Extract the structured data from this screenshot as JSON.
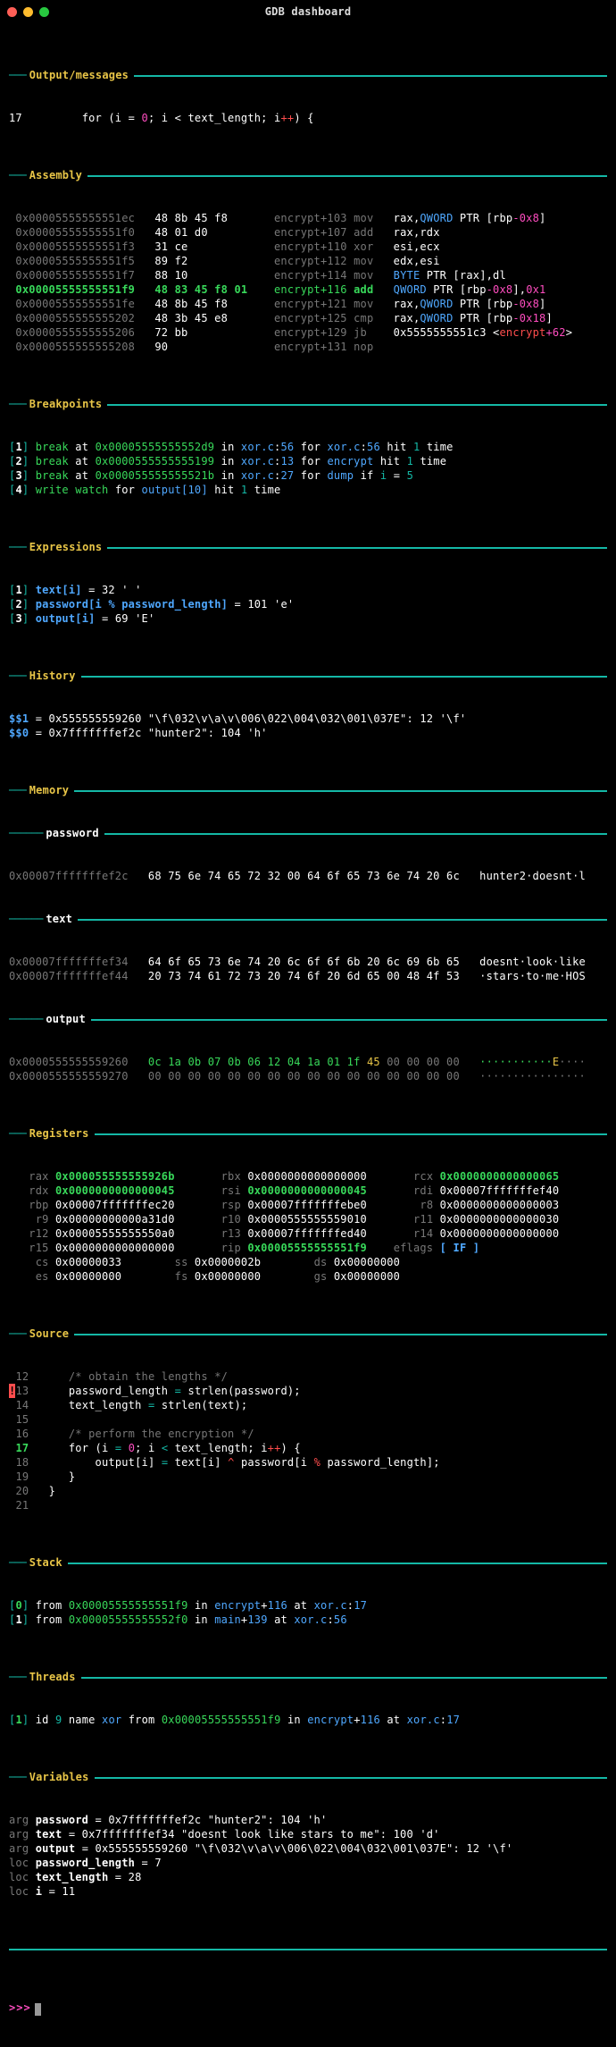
{
  "window": {
    "title": "GDB dashboard"
  },
  "sections": {
    "output_messages": "Output/messages",
    "assembly": "Assembly",
    "breakpoints": "Breakpoints",
    "expressions": "Expressions",
    "history": "History",
    "memory": "Memory",
    "registers": "Registers",
    "source": "Source",
    "stack": "Stack",
    "threads": "Threads",
    "variables": "Variables"
  },
  "output_line": {
    "num": "17",
    "prefix": "for (i = ",
    "zero": "0",
    "mid": "; i < text_length; i",
    "op": "++",
    "end": ") {"
  },
  "assembly": [
    {
      "addr": " 0x00005555555551ec ",
      "bytes": "  48 8b 45 f8       ",
      "loc": "encrypt+103 ",
      "mn": "mov   ",
      "ops": [
        [
          "wh",
          "rax,"
        ],
        [
          "bl",
          "QWORD"
        ],
        [
          "wh",
          " PTR [rbp"
        ],
        [
          "pk",
          "-0x8"
        ],
        [
          "wh",
          "]"
        ]
      ]
    },
    {
      "addr": " 0x00005555555551f0 ",
      "bytes": "  48 01 d0          ",
      "loc": "encrypt+107 ",
      "mn": "add   ",
      "ops": [
        [
          "wh",
          "rax,rdx"
        ]
      ]
    },
    {
      "addr": " 0x00005555555551f3 ",
      "bytes": "  31 ce             ",
      "loc": "encrypt+110 ",
      "mn": "xor   ",
      "ops": [
        [
          "wh",
          "esi,ecx"
        ]
      ]
    },
    {
      "addr": " 0x00005555555551f5 ",
      "bytes": "  89 f2             ",
      "loc": "encrypt+112 ",
      "mn": "mov   ",
      "ops": [
        [
          "wh",
          "edx,esi"
        ]
      ]
    },
    {
      "addr": " 0x00005555555551f7 ",
      "bytes": "  88 10             ",
      "loc": "encrypt+114 ",
      "mn": "mov   ",
      "ops": [
        [
          "bl",
          "BYTE"
        ],
        [
          "wh",
          " PTR [rax],dl"
        ]
      ]
    },
    {
      "addr": " 0x00005555555551f9 ",
      "bytes": "  48 83 45 f8 01    ",
      "loc": "encrypt+116 ",
      "mn": "add   ",
      "ops": [
        [
          "bl",
          "QWORD"
        ],
        [
          "wh",
          " PTR [rbp"
        ],
        [
          "pk",
          "-0x8"
        ],
        [
          "wh",
          "],"
        ],
        [
          "pk",
          "0x1"
        ]
      ],
      "cur": true
    },
    {
      "addr": " 0x00005555555551fe ",
      "bytes": "  48 8b 45 f8       ",
      "loc": "encrypt+121 ",
      "mn": "mov   ",
      "ops": [
        [
          "wh",
          "rax,"
        ],
        [
          "bl",
          "QWORD"
        ],
        [
          "wh",
          " PTR [rbp"
        ],
        [
          "pk",
          "-0x8"
        ],
        [
          "wh",
          "]"
        ]
      ]
    },
    {
      "addr": " 0x0000555555555202 ",
      "bytes": "  48 3b 45 e8       ",
      "loc": "encrypt+125 ",
      "mn": "cmp   ",
      "ops": [
        [
          "wh",
          "rax,"
        ],
        [
          "bl",
          "QWORD"
        ],
        [
          "wh",
          " PTR [rbp"
        ],
        [
          "pk",
          "-0x18"
        ],
        [
          "wh",
          "]"
        ]
      ]
    },
    {
      "addr": " 0x0000555555555206 ",
      "bytes": "  72 bb             ",
      "loc": "encrypt+129 ",
      "mn": "jb    ",
      "ops": [
        [
          "wh",
          "0x5555555551c3 <"
        ],
        [
          "rd",
          "encrypt"
        ],
        [
          "pk",
          "+62"
        ],
        [
          "wh",
          ">"
        ]
      ]
    },
    {
      "addr": " 0x0000555555555208 ",
      "bytes": "  90                ",
      "loc": "encrypt+131 ",
      "mn": "nop",
      "ops": []
    }
  ],
  "breakpoints": [
    {
      "n": "1",
      "tokens": [
        [
          "gr",
          "break"
        ],
        [
          "wh",
          " at "
        ],
        [
          "gr",
          "0x00005555555552d9"
        ],
        [
          "wh",
          " in "
        ],
        [
          "bl",
          "xor.c"
        ],
        [
          "wh",
          ":"
        ],
        [
          "bl",
          "56"
        ],
        [
          "wh",
          " for "
        ],
        [
          "bl",
          "xor.c"
        ],
        [
          "wh",
          ":"
        ],
        [
          "bl",
          "56"
        ],
        [
          "wh",
          " hit "
        ],
        [
          "cy",
          "1"
        ],
        [
          "wh",
          " time"
        ]
      ]
    },
    {
      "n": "2",
      "tokens": [
        [
          "gr",
          "break"
        ],
        [
          "wh",
          " at "
        ],
        [
          "gr",
          "0x0000555555555199"
        ],
        [
          "wh",
          " in "
        ],
        [
          "bl",
          "xor.c"
        ],
        [
          "wh",
          ":"
        ],
        [
          "bl",
          "13"
        ],
        [
          "wh",
          " for "
        ],
        [
          "bl",
          "encrypt"
        ],
        [
          "wh",
          " hit "
        ],
        [
          "cy",
          "1"
        ],
        [
          "wh",
          " time"
        ]
      ]
    },
    {
      "n": "3",
      "tokens": [
        [
          "gr",
          "break"
        ],
        [
          "wh",
          " at "
        ],
        [
          "gr",
          "0x000055555555521b"
        ],
        [
          "wh",
          " in "
        ],
        [
          "bl",
          "xor.c"
        ],
        [
          "wh",
          ":"
        ],
        [
          "bl",
          "27"
        ],
        [
          "wh",
          " for "
        ],
        [
          "bl",
          "dump"
        ],
        [
          "wh",
          " if "
        ],
        [
          "cy",
          "i"
        ],
        [
          "wh",
          " = "
        ],
        [
          "cy",
          "5"
        ]
      ]
    },
    {
      "n": "4",
      "tokens": [
        [
          "gr",
          "write watch"
        ],
        [
          "wh",
          " for "
        ],
        [
          "bl",
          "output[10]"
        ],
        [
          "wh",
          " hit "
        ],
        [
          "cy",
          "1"
        ],
        [
          "wh",
          " time"
        ]
      ]
    }
  ],
  "expressions": [
    {
      "n": "1",
      "lhs": "text[i]",
      "rhs": " = 32 ' '"
    },
    {
      "n": "2",
      "lhs": "password[i % password_length]",
      "rhs": " = 101 'e'"
    },
    {
      "n": "3",
      "lhs": "output[i]",
      "rhs": " = 69 'E'"
    }
  ],
  "history": [
    {
      "id": "$$1",
      "rest": " = 0x555555559260 \"\\f\\032\\v\\a\\v\\006\\022\\004\\032\\001\\037E\": 12 '\\f'"
    },
    {
      "id": "$$0",
      "rest": " = 0x7fffffffef2c \"hunter2\": 104 'h'"
    }
  ],
  "memory": {
    "sub1": "password",
    "rows1": [
      {
        "addr": "0x00007fffffffef2c ",
        "hex": "  68 75 6e 74 65 72 32 00 64 6f 65 73 6e 74 20 6c  ",
        "ascii": " hunter2·doesnt·l"
      }
    ],
    "sub2": "text",
    "rows2": [
      {
        "addr": "0x00007fffffffef34 ",
        "hex": "  64 6f 65 73 6e 74 20 6c 6f 6f 6b 20 6c 69 6b 65  ",
        "ascii": " doesnt·look·like"
      },
      {
        "addr": "0x00007fffffffef44 ",
        "hex": "  20 73 74 61 72 73 20 74 6f 20 6d 65 00 48 4f 53  ",
        "ascii": " ·stars·to·me·HOS"
      }
    ],
    "sub3": "output",
    "rows3": [
      {
        "addr": "0x0000555555559260 ",
        "hexparts": [
          [
            "gr",
            "  0c 1a 0b 07 0b 06 12 04 1a 01 1f"
          ],
          [
            "ye",
            " 45"
          ],
          [
            "dim",
            " 00 00 00 00  "
          ]
        ],
        "asciiparts": [
          [
            "gr",
            " ···········"
          ],
          [
            "ye",
            "E"
          ],
          [
            "dim",
            "····"
          ]
        ]
      },
      {
        "addr": "0x0000555555559270 ",
        "hexparts": [
          [
            "dim",
            "  00 00 00 00 00 00 00 00 00 00 00 00 00 00 00 00  "
          ]
        ],
        "asciiparts": [
          [
            "dim",
            " ················"
          ]
        ]
      }
    ]
  },
  "registers": [
    [
      [
        "rax",
        "0x000055555555926b",
        true
      ],
      [
        "rbx",
        "0x0000000000000000",
        false
      ],
      [
        "rcx",
        "0x0000000000000065",
        true
      ]
    ],
    [
      [
        "rdx",
        "0x0000000000000045",
        true
      ],
      [
        "rsi",
        "0x0000000000000045",
        true
      ],
      [
        "rdi",
        "0x00007fffffffef40",
        false
      ]
    ],
    [
      [
        "rbp",
        "0x00007fffffffec20",
        false
      ],
      [
        "rsp",
        "0x00007fffffffebe0",
        false
      ],
      [
        " r8",
        "0x0000000000000003",
        false
      ]
    ],
    [
      [
        " r9",
        "0x00000000000a31d0",
        false
      ],
      [
        "r10",
        "0x0000555555559010",
        false
      ],
      [
        "r11",
        "0x0000000000000030",
        false
      ]
    ],
    [
      [
        "r12",
        "0x00005555555550a0",
        false
      ],
      [
        "r13",
        "0x00007fffffffed40",
        false
      ],
      [
        "r14",
        "0x0000000000000000",
        false
      ]
    ],
    [
      [
        "r15",
        "0x0000000000000000",
        false
      ],
      [
        "rip",
        "0x00005555555551f9",
        true
      ]
    ],
    [
      [
        " cs",
        "0x00000033",
        false
      ],
      [
        " ss",
        "0x0000002b",
        false
      ],
      [
        " ds",
        "0x00000000",
        false
      ]
    ],
    [
      [
        " es",
        "0x00000000",
        false
      ],
      [
        " fs",
        "0x00000000",
        false
      ],
      [
        " gs",
        "0x00000000",
        false
      ]
    ]
  ],
  "eflags": "[ IF ]",
  "source": [
    {
      "n": "12",
      "t": [
        [
          "dim",
          "/* obtain the lengths */"
        ]
      ]
    },
    {
      "n": "13",
      "bp": true,
      "t": [
        [
          "wh",
          "password_length "
        ],
        [
          "cy",
          "="
        ],
        [
          "wh",
          " strlen(password);"
        ]
      ]
    },
    {
      "n": "14",
      "t": [
        [
          "wh",
          "text_length "
        ],
        [
          "cy",
          "="
        ],
        [
          "wh",
          " strlen(text);"
        ]
      ]
    },
    {
      "n": "15",
      "t": [
        [
          "wh",
          ""
        ]
      ]
    },
    {
      "n": "16",
      "t": [
        [
          "dim",
          "/* perform the encryption */"
        ]
      ]
    },
    {
      "n": "17",
      "cur": true,
      "t": [
        [
          "wh",
          "for (i "
        ],
        [
          "cy",
          "="
        ],
        [
          "wh",
          " "
        ],
        [
          "pk",
          "0"
        ],
        [
          "wh",
          "; i "
        ],
        [
          "cy",
          "<"
        ],
        [
          "wh",
          " text_length; i"
        ],
        [
          "rd",
          "++"
        ],
        [
          "wh",
          ") {"
        ]
      ]
    },
    {
      "n": "18",
      "t": [
        [
          "wh",
          "    output[i] "
        ],
        [
          "cy",
          "="
        ],
        [
          "wh",
          " text[i] "
        ],
        [
          "rd",
          "^"
        ],
        [
          "wh",
          " password[i "
        ],
        [
          "rd",
          "%"
        ],
        [
          "wh",
          " password_length];"
        ]
      ]
    },
    {
      "n": "19",
      "t": [
        [
          "wh",
          "}"
        ]
      ]
    },
    {
      "n": "20",
      "t": [
        [
          "wh",
          "}"
        ]
      ],
      "dedent": true
    },
    {
      "n": "21",
      "t": [
        [
          "wh",
          ""
        ]
      ]
    }
  ],
  "stack": [
    {
      "n": "0",
      "cur": true,
      "tokens": [
        [
          "wh",
          "from "
        ],
        [
          "gr",
          "0x00005555555551f9"
        ],
        [
          "wh",
          " in "
        ],
        [
          "bl",
          "encrypt"
        ],
        [
          "wh",
          "+"
        ],
        [
          "bl",
          "116"
        ],
        [
          "wh",
          " at "
        ],
        [
          "bl",
          "xor.c"
        ],
        [
          "wh",
          ":"
        ],
        [
          "bl",
          "17"
        ]
      ]
    },
    {
      "n": "1",
      "tokens": [
        [
          "wh",
          "from "
        ],
        [
          "gr",
          "0x00005555555552f0"
        ],
        [
          "wh",
          " in "
        ],
        [
          "bl",
          "main"
        ],
        [
          "wh",
          "+"
        ],
        [
          "bl",
          "139"
        ],
        [
          "wh",
          " at "
        ],
        [
          "bl",
          "xor.c"
        ],
        [
          "wh",
          ":"
        ],
        [
          "bl",
          "56"
        ]
      ]
    }
  ],
  "threads": [
    {
      "n": "1",
      "tokens": [
        [
          "wh",
          "id "
        ],
        [
          "cy",
          "9"
        ],
        [
          "wh",
          " name "
        ],
        [
          "bl",
          "xor"
        ],
        [
          "wh",
          " from "
        ],
        [
          "gr",
          "0x00005555555551f9"
        ],
        [
          "wh",
          " in "
        ],
        [
          "bl",
          "encrypt"
        ],
        [
          "wh",
          "+"
        ],
        [
          "bl",
          "116"
        ],
        [
          "wh",
          " at "
        ],
        [
          "bl",
          "xor.c"
        ],
        [
          "wh",
          ":"
        ],
        [
          "bl",
          "17"
        ]
      ]
    }
  ],
  "variables": [
    {
      "kind": "arg",
      "name": "password",
      "rest": " = 0x7fffffffef2c \"hunter2\": 104 'h'"
    },
    {
      "kind": "arg",
      "name": "text",
      "rest": " = 0x7fffffffef34 \"doesnt look like stars to me\": 100 'd'"
    },
    {
      "kind": "arg",
      "name": "output",
      "rest": " = 0x555555559260 \"\\f\\032\\v\\a\\v\\006\\022\\004\\032\\001\\037E\": 12 '\\f'"
    },
    {
      "kind": "loc",
      "name": "password_length",
      "rest": " = 7"
    },
    {
      "kind": "loc",
      "name": "text_length",
      "rest": " = 28"
    },
    {
      "kind": "loc",
      "name": "i",
      "rest": " = 11"
    }
  ],
  "prompt": ">>>"
}
